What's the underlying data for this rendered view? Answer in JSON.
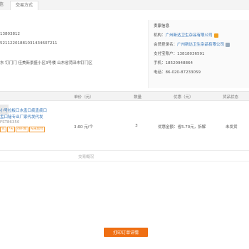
{
  "tabs": [
    {
      "label": "信"
    },
    {
      "label": "交易方式"
    }
  ],
  "order": {
    "line1": "13803812",
    "line2": "52112201881031434607211",
    "address": "东 钉门门 佳美新景盛小区3号楼 山东省菏泽市钉门区"
  },
  "seller": {
    "title": "卖家信息",
    "company_label": "机构：",
    "company_value": "广州新达卫生杂品有限公司",
    "member_label": "会员登录名：",
    "member_value": "广州新达卫生杂品有限公司",
    "alipay_label": "支付宝账户：",
    "alipay_value": "13818036591",
    "mobile_label": "手机：",
    "mobile_value": "18520948864",
    "phone_label": "电话：",
    "phone_value": "86-020-87233059"
  },
  "table": {
    "headers": {
      "price": "单价（元）",
      "qty": "数量",
      "discount": "优惠（元）",
      "status": "货品状态"
    }
  },
  "item": {
    "title_line1": "小号拉板口水盂口痰盂痰口",
    "title_line2": "盂口秘专业厂家代发代发",
    "code": "FST86350",
    "tags": [
      "包",
      "7天",
      "48H发",
      "先采后付"
    ],
    "price": "3.60 元/个",
    "qty": "3",
    "discount": "优惠金额：省5.70元，拆解",
    "status": "未发货"
  },
  "more_info": "交易概况",
  "print_button": "打印订单详情"
}
